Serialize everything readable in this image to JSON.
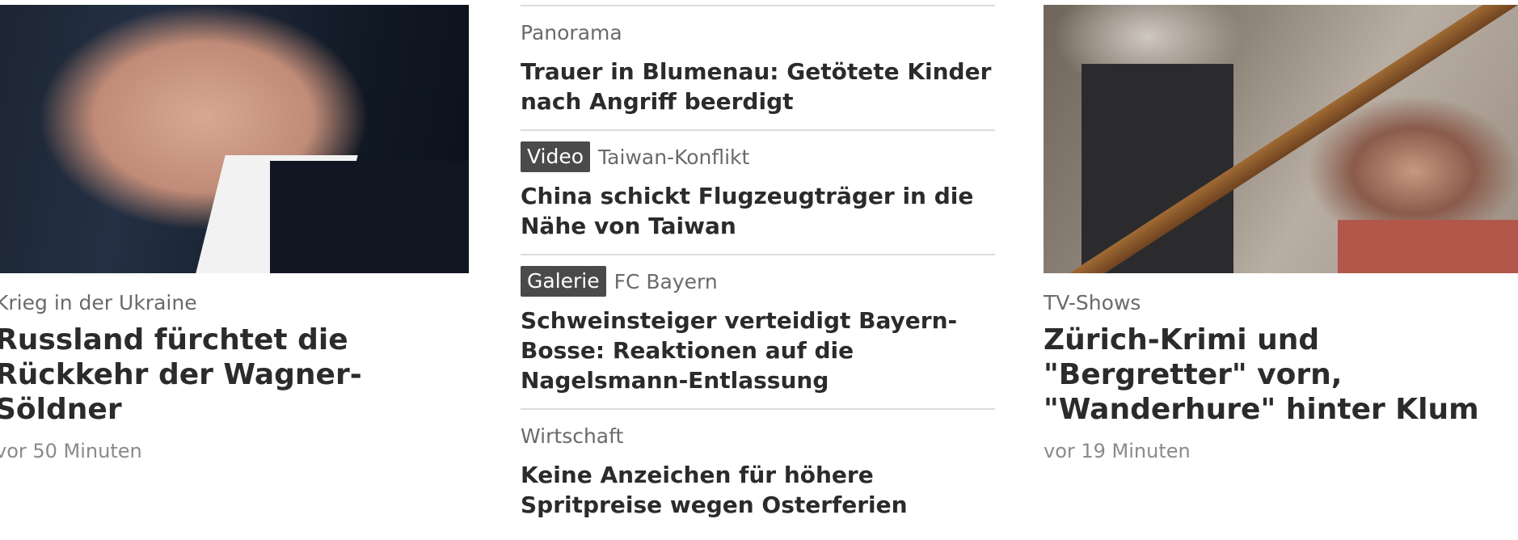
{
  "left_article": {
    "image_alt": "Portrait of a bald man in a dark suit",
    "category": "Krieg in der Ukraine",
    "headline": "Russland fürchtet die Rückkehr der Wagner-Söldner",
    "time": "vor 50 Minuten"
  },
  "middle_list": [
    {
      "badge": "",
      "category": "Panorama",
      "headline": "Trauer in Blumenau: Getötete Kinder nach Angriff beerdigt"
    },
    {
      "badge": "Video",
      "category": "Taiwan-Konflikt",
      "headline": "China schickt Flugzeugträger in die Nähe von Taiwan"
    },
    {
      "badge": "Galerie",
      "category": "FC Bayern",
      "headline": "Schweinsteiger verteidigt Bayern-Bosse: Reaktionen auf die Nagelsmann-Entlassung"
    },
    {
      "badge": "",
      "category": "Wirtschaft",
      "headline": "Keine Anzeichen für höhere Spritpreise wegen Osterferien"
    }
  ],
  "right_article": {
    "image_alt": "Scene from a TV crime show with a man and a woman on a staircase",
    "category": "TV-Shows",
    "headline": "Zürich-Krimi und \"Bergretter\" vorn, \"Wanderhure\" hinter Klum",
    "time": "vor 19 Minuten"
  },
  "colors": {
    "text": "#2b2b2b",
    "kicker": "#6a6a6a",
    "badge_bg": "#4a4a4a",
    "rule": "#dcdcdc"
  }
}
